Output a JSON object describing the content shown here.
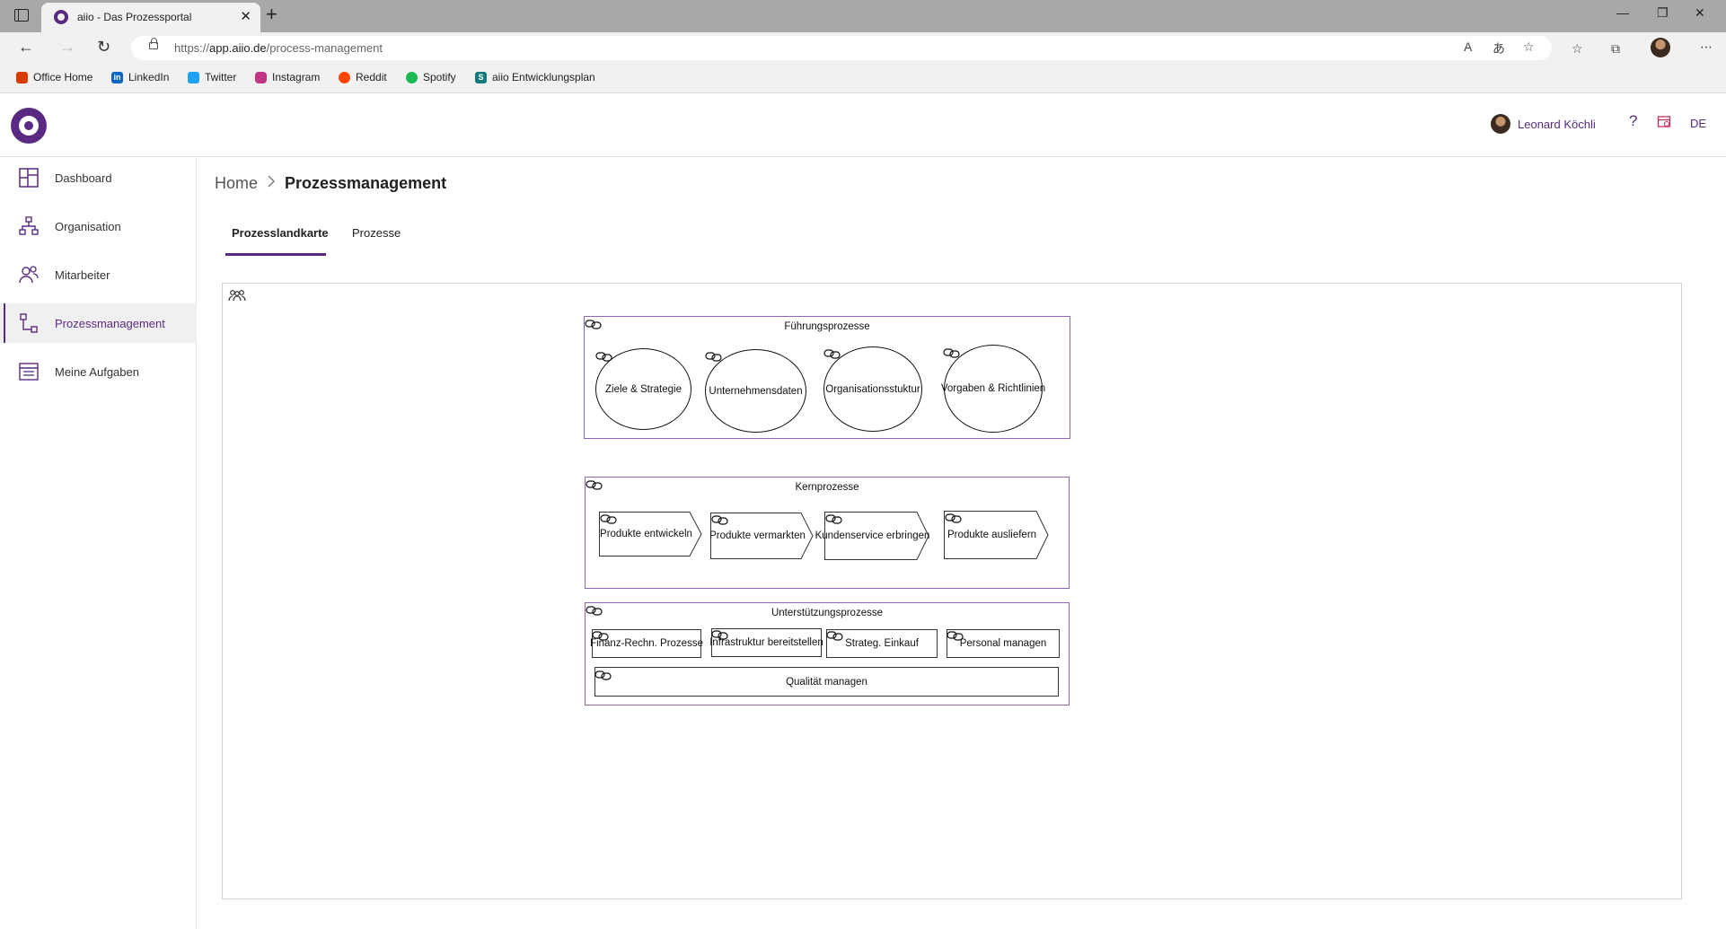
{
  "browser": {
    "tab_title": "aiio - Das Prozessportal",
    "url_prefix": "https://",
    "url_domain": "app.aiio.de",
    "url_path": "/process-management",
    "bookmarks": [
      {
        "label": "Office Home",
        "color": "#d83b01"
      },
      {
        "label": "LinkedIn",
        "color": "#0a66c2"
      },
      {
        "label": "Twitter",
        "color": "#1da1f2"
      },
      {
        "label": "Instagram",
        "color": "#c13584"
      },
      {
        "label": "Reddit",
        "color": "#ff4500"
      },
      {
        "label": "Spotify",
        "color": "#1db954"
      },
      {
        "label": "aiio Entwicklungsplan",
        "color": "#127a7a"
      }
    ]
  },
  "header": {
    "user_name": "Leonard Köchli",
    "help_label": "?",
    "language": "DE"
  },
  "sidebar": {
    "items": [
      {
        "label": "Dashboard",
        "icon": "dashboard-icon"
      },
      {
        "label": "Organisation",
        "icon": "org-chart-icon"
      },
      {
        "label": "Mitarbeiter",
        "icon": "people-icon"
      },
      {
        "label": "Prozessmanagement",
        "icon": "process-icon",
        "active": true
      },
      {
        "label": "Meine Aufgaben",
        "icon": "tasks-icon"
      }
    ]
  },
  "breadcrumb": {
    "home": "Home",
    "separator": ">",
    "current": "Prozessmanagement"
  },
  "tabs": [
    {
      "label": "Prozesslandkarte",
      "active": true
    },
    {
      "label": "Prozesse",
      "active": false
    }
  ],
  "process_map": {
    "lanes": [
      {
        "title": "Führungsprozesse",
        "shape": "circle",
        "nodes": [
          "Ziele & Strategie",
          "Unternehmensdaten",
          "Organisationsstuktur",
          "Vorgaben & Richtlinien"
        ]
      },
      {
        "title": "Kernprozesse",
        "shape": "arrow",
        "nodes": [
          "Produkte entwickeln",
          "Produkte vermarkten",
          "Kundenservice erbringen",
          "Produkte ausliefern"
        ]
      },
      {
        "title": "Unterstützungsprozesse",
        "shape": "rect",
        "nodes": [
          "Finanz-Rechn. Prozesse",
          "Infrastruktur bereitstellen",
          "Strateg. Einkauf",
          "Personal managen",
          "Qualität managen"
        ]
      }
    ]
  },
  "colors": {
    "accent": "#5a2a82",
    "lane_border": "#8a68b0"
  }
}
